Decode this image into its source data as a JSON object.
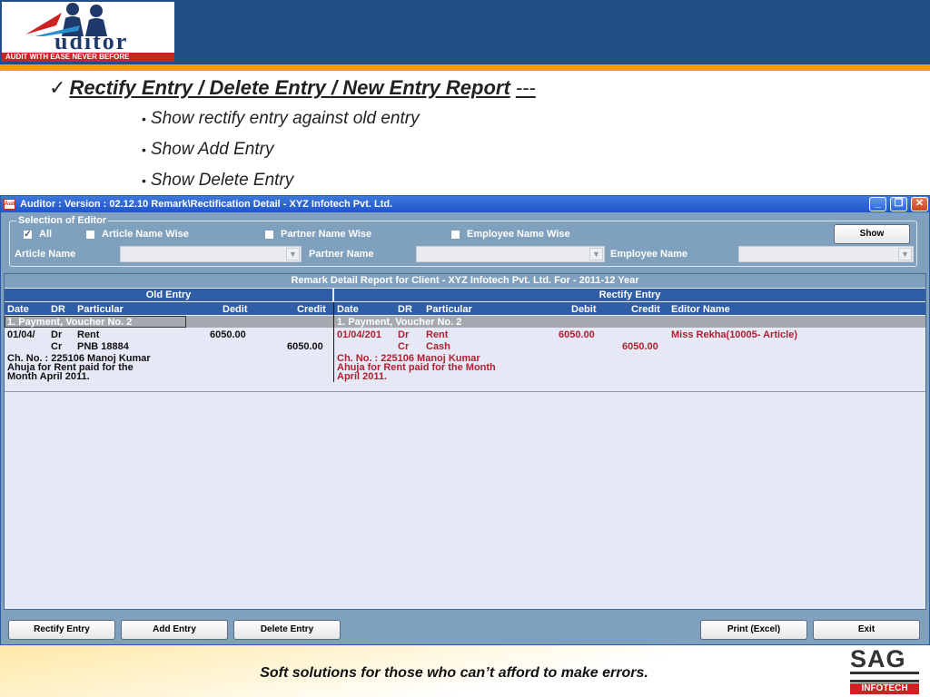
{
  "slide": {
    "logo_text": "uditor",
    "logo_tagline": "AUDIT WITH EASE NEVER BEFORE",
    "heading": "Rectify Entry / Delete Entry / New Entry Report",
    "heading_suffix": "---",
    "bullets": [
      "Show rectify entry against old entry",
      "Show Add Entry",
      "Show Delete Entry"
    ],
    "footer": "Soft solutions for those who can’t afford to make errors.",
    "brand": {
      "name": "SAG",
      "sub": "INFOTECH"
    }
  },
  "window": {
    "title": "Auditor : Version : 02.12.10 Remark\\Rectification Detail - XYZ Infotech Pvt. Ltd.",
    "icon_text": "Aud"
  },
  "selection": {
    "group_title": "Selection of Editor",
    "options": [
      {
        "label": "All",
        "checked": true
      },
      {
        "label": "Article Name Wise",
        "checked": false
      },
      {
        "label": "Partner Name Wise",
        "checked": false
      },
      {
        "label": "Employee Name Wise",
        "checked": false
      }
    ],
    "show_button": "Show",
    "fields": [
      {
        "label": "Article Name",
        "value": ""
      },
      {
        "label": "Partner Name",
        "value": ""
      },
      {
        "label": "Employee Name",
        "value": ""
      }
    ]
  },
  "report": {
    "title": "Remark Detail Report for Client - XYZ Infotech Pvt. Ltd. For - 2011-12 Year",
    "old_entry": {
      "header": "Old Entry",
      "columns": {
        "date": "Date",
        "dr": "DR",
        "particular": "Particular",
        "debit": "Dedit",
        "credit": "Credit"
      },
      "group": "1. Payment, Voucher No. 2",
      "rows": [
        {
          "date": "01/04/",
          "dr": "Dr",
          "particular": "Rent",
          "debit": "6050.00",
          "credit": ""
        },
        {
          "date": "",
          "dr": "Cr",
          "particular": "PNB 18884",
          "debit": "",
          "credit": "6050.00"
        }
      ],
      "narration": [
        "Ch. No. : 225106 Manoj Kumar",
        "Ahuja for Rent paid for the",
        "Month April 2011."
      ]
    },
    "rectify_entry": {
      "header": "Rectify Entry",
      "columns": {
        "date": "Date",
        "dr": "DR",
        "particular": "Particular",
        "debit": "Debit",
        "credit": "Credit",
        "editor": "Editor Name"
      },
      "group": "1. Payment, Voucher No. 2",
      "rows": [
        {
          "date": "01/04/201",
          "dr": "Dr",
          "particular": "Rent",
          "debit": "6050.00",
          "credit": "",
          "editor": "Miss Rekha(10005- Article)"
        },
        {
          "date": "",
          "dr": "Cr",
          "particular": "Cash",
          "debit": "",
          "credit": "6050.00",
          "editor": ""
        }
      ],
      "narration": [
        "Ch. No. : 225106 Manoj Kumar",
        "Ahuja for Rent paid for the Month",
        "April 2011."
      ]
    }
  },
  "buttons": {
    "rectify": "Rectify Entry",
    "add": "Add Entry",
    "delete": "Delete Entry",
    "print": "Print (Excel)",
    "exit": "Exit"
  },
  "colors": {
    "header_blue": "#1f4f85",
    "accent_orange": "#f39a1a",
    "panel": "#7fa1be",
    "grid_header": "#2f5ea6",
    "rectify_text": "#b02030"
  }
}
